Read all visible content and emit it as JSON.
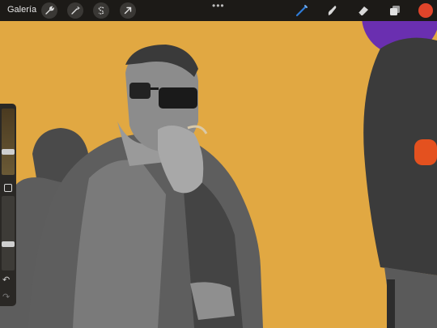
{
  "topbar": {
    "gallery_label": "Galería",
    "left_tools": [
      {
        "name": "wrench-icon"
      },
      {
        "name": "magic-wand-icon"
      },
      {
        "name": "selection-s-icon"
      },
      {
        "name": "transform-arrow-icon"
      }
    ],
    "more_label": "•••",
    "right_tools": [
      {
        "name": "brush-icon",
        "color": "#2e7bd7"
      },
      {
        "name": "smudge-icon",
        "color": "#d8d8d8"
      },
      {
        "name": "eraser-icon",
        "color": "#d8d8d8"
      },
      {
        "name": "layers-icon",
        "color": "#d8d8d8"
      }
    ],
    "current_color": "#e0442a"
  },
  "sidebar": {
    "brush_size": 0.35,
    "opacity": 0.35,
    "undo_label": "↶",
    "redo_label": "↷"
  },
  "canvas": {
    "background": "#e1a842",
    "accent_purple": "#6a2fb0",
    "accent_orange": "#e4511f"
  }
}
